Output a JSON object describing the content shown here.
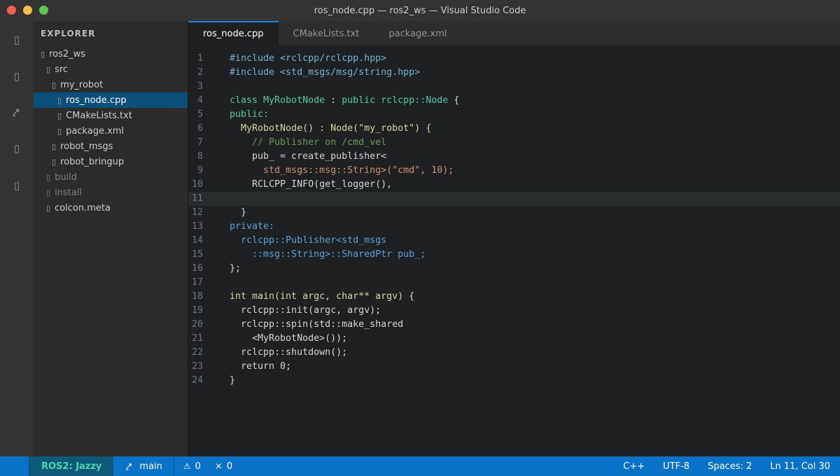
{
  "window": {
    "title": "ros_node.cpp — ros2_ws — Visual Studio Code",
    "traffic_lights": [
      {
        "name": "close-button",
        "color": "#ee5f52"
      },
      {
        "name": "minimize-button",
        "color": "#f5bd4f"
      },
      {
        "name": "zoom-button",
        "color": "#5fc454"
      }
    ]
  },
  "activity_bar": {
    "items": [
      {
        "name": "explorer-icon",
        "glyph": "▯"
      },
      {
        "name": "search-icon",
        "glyph": "▯"
      },
      {
        "name": "source-control-icon",
        "glyph": "arrow-svg"
      },
      {
        "name": "run-debug-icon",
        "glyph": "▯"
      },
      {
        "name": "extensions-icon",
        "glyph": "▯"
      }
    ],
    "tops": [
      14,
      66,
      117,
      169,
      222
    ]
  },
  "sidebar": {
    "header": "EXPLORER",
    "items": [
      {
        "label": "ros2_ws",
        "indent": 0,
        "icon": "folder-icon"
      },
      {
        "label": "src",
        "indent": 1,
        "icon": "folder-icon"
      },
      {
        "label": "my_robot",
        "indent": 2,
        "icon": "folder-icon"
      },
      {
        "label": "ros_node.cpp",
        "indent": 3,
        "icon": "file-icon",
        "selected": true
      },
      {
        "label": "CMakeLists.txt",
        "indent": 3,
        "icon": "file-icon"
      },
      {
        "label": "package.xml",
        "indent": 3,
        "icon": "file-icon"
      },
      {
        "label": "robot_msgs",
        "indent": 2,
        "icon": "folder-icon"
      },
      {
        "label": "robot_bringup",
        "indent": 2,
        "icon": "folder-icon"
      },
      {
        "label": "build",
        "indent": 1,
        "icon": "folder-icon",
        "dimmed": true
      },
      {
        "label": "install",
        "indent": 1,
        "icon": "folder-icon",
        "dimmed": true
      },
      {
        "label": "colcon.meta",
        "indent": 1,
        "icon": "file-icon"
      }
    ],
    "glyph": "▯",
    "selection_color": "#0b4f79"
  },
  "tabs": [
    {
      "label": "ros_node.cpp",
      "active": true
    },
    {
      "label": "CMakeLists.txt",
      "active": false
    },
    {
      "label": "package.xml",
      "active": false
    }
  ],
  "editor": {
    "current_line": 11,
    "token_colors": {
      "include": "#74b2d4",
      "type": "#4ec9a6",
      "func": "#d7d3a0",
      "comment": "#6a9955",
      "string": "#ce9178",
      "member": "#5b9fd8",
      "plain": "#d4d4d4"
    },
    "lines": [
      {
        "num": 1,
        "segments": [
          {
            "text": "#include <rclcpp/rclcpp.hpp>",
            "color": "include"
          }
        ]
      },
      {
        "num": 2,
        "segments": [
          {
            "text": "#include <std_msgs/msg/string.hpp>",
            "color": "include"
          }
        ]
      },
      {
        "num": 3,
        "segments": []
      },
      {
        "num": 4,
        "segments": [
          {
            "text": "class MyRobotNode",
            "color": "type"
          },
          {
            "text": " : ",
            "color": "plain"
          },
          {
            "text": "public rclcpp::Node",
            "color": "type"
          },
          {
            "text": " {",
            "color": "plain"
          }
        ]
      },
      {
        "num": 5,
        "segments": [
          {
            "text": "public:",
            "color": "type"
          }
        ]
      },
      {
        "num": 6,
        "segments": [
          {
            "text": "  MyRobotNode() : Node(\"my_robot\") {",
            "color": "func"
          }
        ]
      },
      {
        "num": 7,
        "segments": [
          {
            "text": "    // Publisher on /cmd_vel",
            "color": "comment"
          }
        ]
      },
      {
        "num": 8,
        "segments": [
          {
            "text": "    pub_ = create_publisher<",
            "color": "plain"
          }
        ]
      },
      {
        "num": 9,
        "segments": [
          {
            "text": "      std_msgs::msg::String>(\"cmd\", 10);",
            "color": "string"
          }
        ]
      },
      {
        "num": 10,
        "segments": [
          {
            "text": "    RCLCPP_INFO(get_logger(),",
            "color": "plain"
          }
        ]
      },
      {
        "num": 11,
        "segments": []
      },
      {
        "num": 12,
        "segments": [
          {
            "text": "  }",
            "color": "plain"
          }
        ]
      },
      {
        "num": 13,
        "segments": [
          {
            "text": "private:",
            "color": "member"
          }
        ]
      },
      {
        "num": 14,
        "segments": [
          {
            "text": "  rclcpp::Publisher<std_msgs",
            "color": "member"
          }
        ]
      },
      {
        "num": 15,
        "segments": [
          {
            "text": "    ::msg::String>::SharedPtr pub_;",
            "color": "member"
          }
        ]
      },
      {
        "num": 16,
        "segments": [
          {
            "text": "};",
            "color": "plain"
          }
        ]
      },
      {
        "num": 17,
        "segments": []
      },
      {
        "num": 18,
        "segments": [
          {
            "text": "int main(int argc, char** argv) {",
            "color": "func"
          }
        ]
      },
      {
        "num": 19,
        "segments": [
          {
            "text": "  rclcpp::init(argc, argv);",
            "color": "plain"
          }
        ]
      },
      {
        "num": 20,
        "segments": [
          {
            "text": "  rclcpp::spin(std::make_shared",
            "color": "plain"
          }
        ]
      },
      {
        "num": 21,
        "segments": [
          {
            "text": "    <MyRobotNode>());",
            "color": "plain"
          }
        ]
      },
      {
        "num": 22,
        "segments": [
          {
            "text": "  rclcpp::shutdown();",
            "color": "plain"
          }
        ]
      },
      {
        "num": 23,
        "segments": [
          {
            "text": "  return 0;",
            "color": "plain"
          }
        ]
      },
      {
        "num": 24,
        "segments": [
          {
            "text": "}",
            "color": "plain"
          }
        ]
      }
    ]
  },
  "status_bar": {
    "background": "#0b73c7",
    "ros_label": "ROS2: Jazzy",
    "ros_bg": "#0d5a78",
    "ros_fg": "#4fd3ae",
    "branch": "main",
    "warning_icon": "⚠",
    "warning_count": "0",
    "error_icon": "×",
    "error_count": "0",
    "language": "C++",
    "encoding": "UTF-8",
    "indentation": "Spaces: 2",
    "cursor_position": "Ln 11, Col 30"
  }
}
